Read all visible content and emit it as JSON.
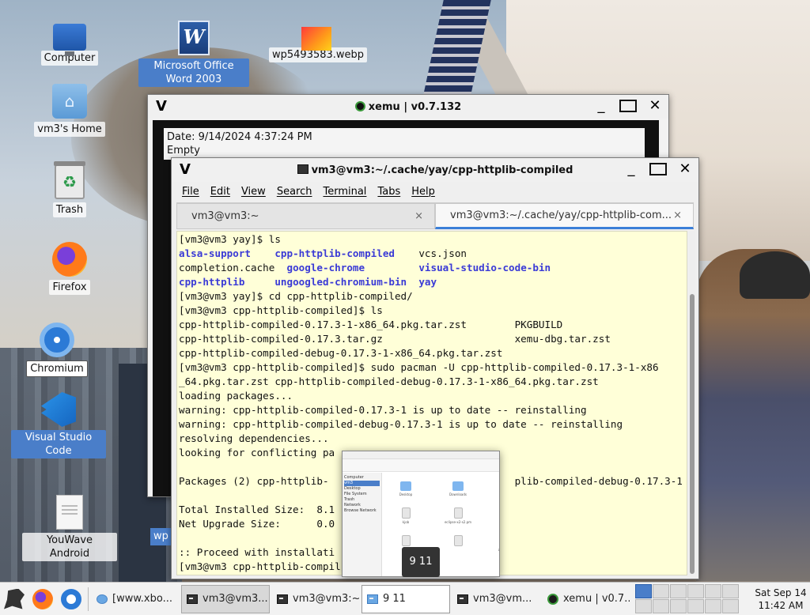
{
  "desktop": {
    "icons": [
      {
        "id": "computer",
        "label": "Computer"
      },
      {
        "id": "word",
        "label": "Microsoft Office Word 2003"
      },
      {
        "id": "webp",
        "label": "wp5493583.webp"
      },
      {
        "id": "home",
        "label": "vm3's Home"
      },
      {
        "id": "trash",
        "label": "Trash"
      },
      {
        "id": "firefox",
        "label": "Firefox"
      },
      {
        "id": "chromium",
        "label": "Chromium"
      },
      {
        "id": "vscode",
        "label": "Visual Studio Code"
      },
      {
        "id": "youwave",
        "label": "YouWave Android"
      }
    ],
    "partial_label": "wp"
  },
  "xemu_window": {
    "title": "xemu | v0.7.132",
    "date_line": "Date: 9/14/2024 4:37:24 PM",
    "status_line": "Empty"
  },
  "terminal": {
    "title": "vm3@vm3:~/.cache/yay/cpp-httplib-compiled",
    "menu": [
      "File",
      "Edit",
      "View",
      "Search",
      "Terminal",
      "Tabs",
      "Help"
    ],
    "tabs": [
      {
        "label": "vm3@vm3:~",
        "active": false
      },
      {
        "label": "vm3@vm3:~/.cache/yay/cpp-httplib-com...",
        "active": true
      }
    ],
    "close_glyph": "×",
    "lines": [
      "[vm3@vm3 yay]$ ls",
      "alsa-support    cpp-httplib-compiled    vcs.json",
      "completion.cache  google-chrome         visual-studio-code-bin",
      "cpp-httplib     ungoogled-chromium-bin  yay",
      "[vm3@vm3 yay]$ cd cpp-httplib-compiled/",
      "[vm3@vm3 cpp-httplib-compiled]$ ls",
      "cpp-httplib-compiled-0.17.3-1-x86_64.pkg.tar.zst        PKGBUILD",
      "cpp-httplib-compiled-0.17.3.tar.gz                      xemu-dbg.tar.zst",
      "cpp-httplib-compiled-debug-0.17.3-1-x86_64.pkg.tar.zst",
      "[vm3@vm3 cpp-httplib-compiled]$ sudo pacman -U cpp-httplib-compiled-0.17.3-1-x86",
      "_64.pkg.tar.zst cpp-httplib-compiled-debug-0.17.3-1-x86_64.pkg.tar.zst",
      "loading packages...",
      "warning: cpp-httplib-compiled-0.17.3-1 is up to date -- reinstalling",
      "warning: cpp-httplib-compiled-debug-0.17.3-1 is up to date -- reinstalling",
      "resolving dependencies...",
      "looking for conflicting pa",
      "",
      "Packages (2) cpp-httplib-                               plib-compiled-debug-0.17.3-1",
      "",
      "Total Installed Size:  8.1",
      "Net Upgrade Size:      0.0",
      "",
      ":: Proceed with installati",
      "[vm3@vm3 cpp-httplib-compil"
    ]
  },
  "file_manager_preview": {
    "sidebar": [
      "Computer",
      "vm3",
      "Desktop",
      "File System",
      "Trash",
      "Network",
      "Browse Network"
    ],
    "files": [
      "Desktop",
      "Downloads",
      "Dprac-cabls",
      "kjob",
      "eclipse-x2-s2.pm",
      "image_10.jpg",
      "",
      "",
      "alsm_link-scroll"
    ],
    "tooltip": "9 11"
  },
  "taskbar": {
    "tasks": [
      {
        "label": "[www.xbo...",
        "icon": "globe-icon",
        "state": "normal"
      },
      {
        "label": "vm3@vm3...",
        "icon": "terminal-icon",
        "state": "active"
      },
      {
        "label": "vm3@vm3:~",
        "icon": "terminal-icon",
        "state": "normal"
      },
      {
        "label": "9 11",
        "icon": "folder-icon",
        "state": "focus"
      },
      {
        "label": "vm3@vm...",
        "icon": "terminal-icon",
        "state": "normal"
      },
      {
        "label": "xemu | v0.7...",
        "icon": "xemu-icon",
        "state": "normal"
      }
    ],
    "clock_day": "Sat Sep 14",
    "clock_time": "11:42 AM"
  }
}
